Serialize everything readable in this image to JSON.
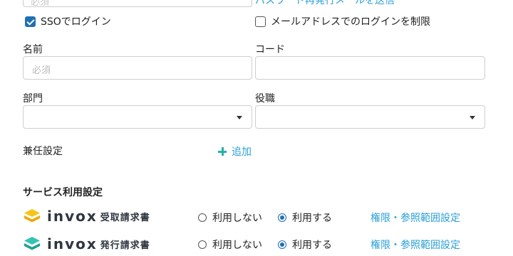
{
  "top": {
    "input_placeholder": "必須",
    "link_text": "パスワード再発行メールを送信"
  },
  "checkboxes": {
    "sso": {
      "label": "SSOでログイン",
      "checked": true
    },
    "email_login": {
      "label": "メールアドレスでのログインを制限",
      "checked": false
    }
  },
  "fields": {
    "name": {
      "label": "名前",
      "placeholder": "必須"
    },
    "code": {
      "label": "コード",
      "placeholder": ""
    },
    "department": {
      "label": "部門",
      "value": ""
    },
    "position": {
      "label": "役職",
      "value": ""
    },
    "concurrent": {
      "label": "兼任設定",
      "add_label": "追加"
    }
  },
  "services": {
    "title": "サービス利用設定",
    "items": [
      {
        "brand": "invox",
        "product": "受取請求書",
        "icon_colors": [
          "#f5c518",
          "#f0a500"
        ],
        "options": [
          "利用しない",
          "利用する"
        ],
        "selected": "利用する",
        "link": "権限・参照範囲設定"
      },
      {
        "brand": "invox",
        "product": "発行請求書",
        "icon_colors": [
          "#34c3b5",
          "#1e9e91"
        ],
        "options": [
          "利用しない",
          "利用する"
        ],
        "selected": "利用する",
        "link": "権限・参照範囲設定"
      }
    ]
  },
  "colors": {
    "link": "#2a9fd6",
    "checkbox": "#1f6fb4",
    "add_plus": "#2ab0a4"
  }
}
